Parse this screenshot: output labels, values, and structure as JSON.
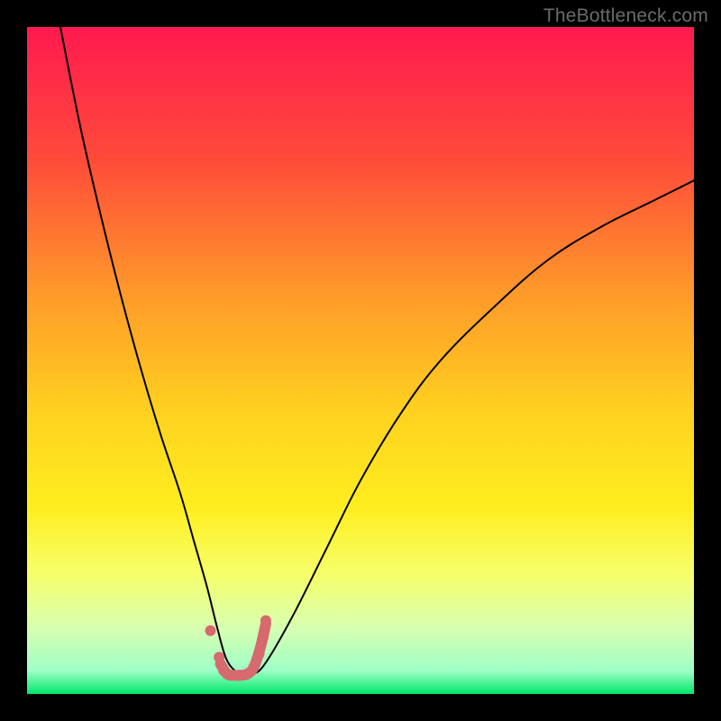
{
  "watermark": "TheBottleneck.com",
  "chart_data": {
    "type": "line",
    "title": "",
    "xlabel": "",
    "ylabel": "",
    "xlim": [
      0,
      100
    ],
    "ylim": [
      0,
      100
    ],
    "legend": false,
    "grid": false,
    "background_gradient": {
      "stops": [
        {
          "offset": 0.0,
          "color": "#ff1a4f"
        },
        {
          "offset": 0.2,
          "color": "#ff4b3a"
        },
        {
          "offset": 0.4,
          "color": "#ff9a2a"
        },
        {
          "offset": 0.58,
          "color": "#ffd21f"
        },
        {
          "offset": 0.72,
          "color": "#ffee1f"
        },
        {
          "offset": 0.82,
          "color": "#f6ff6a"
        },
        {
          "offset": 0.9,
          "color": "#d8ffb0"
        },
        {
          "offset": 0.965,
          "color": "#9fffc7"
        },
        {
          "offset": 1.0,
          "color": "#00e76a"
        }
      ]
    },
    "series": [
      {
        "name": "bottleneck-curve",
        "stroke": "#000000",
        "stroke_width": 2,
        "x": [
          5,
          8,
          11,
          14,
          17,
          20,
          23,
          25,
          27,
          28.5,
          30,
          32,
          34,
          36,
          40,
          45,
          50,
          56,
          62,
          70,
          78,
          86,
          94,
          100
        ],
        "values": [
          100,
          85,
          72,
          60,
          49,
          39,
          30,
          23,
          16,
          10,
          5,
          3,
          3,
          5,
          12,
          22,
          32,
          42,
          50,
          58,
          65,
          70,
          74,
          77
        ]
      }
    ],
    "overlays": [
      {
        "name": "valley-marker-dots",
        "type": "scatter",
        "color": "#d66a6e",
        "radius_px": 6,
        "x": [
          27.5,
          28.8,
          29.5,
          30.5,
          31.8,
          33.0,
          34.0,
          34.8,
          35.4,
          35.8
        ],
        "values": [
          9.5,
          5.5,
          3.5,
          2.8,
          2.8,
          3.0,
          4.0,
          6.0,
          8.5,
          11.0
        ]
      },
      {
        "name": "valley-marker-segment",
        "type": "line",
        "color": "#d66a6e",
        "stroke_width_px": 12,
        "x": [
          29.0,
          30.0,
          31.0,
          32.0,
          33.0,
          34.0,
          35.0,
          35.8
        ],
        "values": [
          4.5,
          3.0,
          2.8,
          2.8,
          3.0,
          4.0,
          7.0,
          10.5
        ]
      }
    ]
  }
}
